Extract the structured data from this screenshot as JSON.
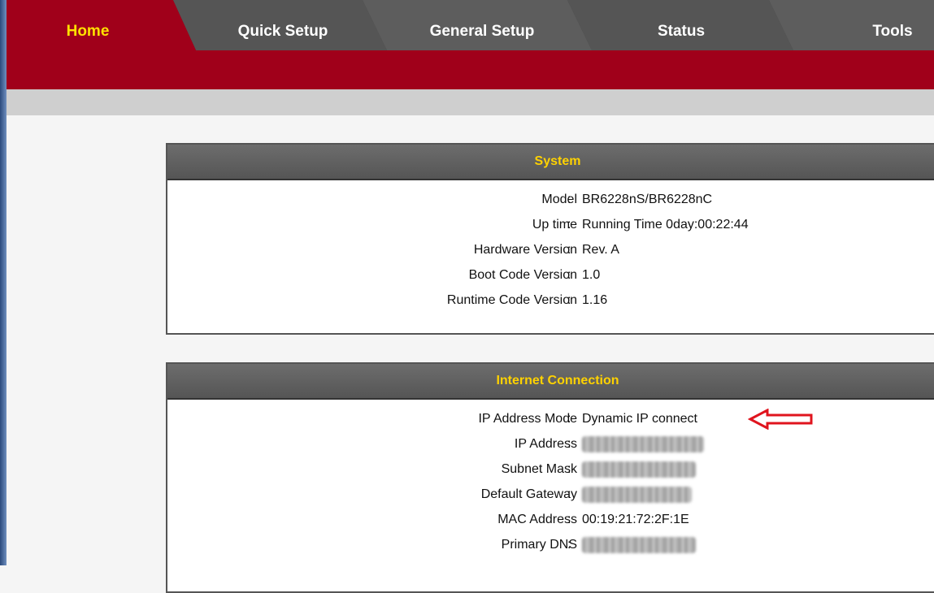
{
  "nav": {
    "tabs": [
      {
        "label": "Home",
        "active": true
      },
      {
        "label": "Quick Setup",
        "active": false
      },
      {
        "label": "General Setup",
        "active": false
      },
      {
        "label": "Status",
        "active": false
      },
      {
        "label": "Tools",
        "active": false
      }
    ]
  },
  "system": {
    "title": "System",
    "rows": [
      {
        "label": "Model",
        "value": "BR6228nS/BR6228nC"
      },
      {
        "label": "Up time",
        "value": "Running Time 0day:00:22:44"
      },
      {
        "label": "Hardware Version",
        "value": "Rev. A"
      },
      {
        "label": "Boot Code Version",
        "value": "1.0"
      },
      {
        "label": "Runtime Code Version",
        "value": "1.16"
      }
    ]
  },
  "internet": {
    "title": "Internet Connection",
    "rows": [
      {
        "label": "IP Address Mode",
        "value": "Dynamic IP connect"
      },
      {
        "label": "IP Address",
        "value": ""
      },
      {
        "label": "Subnet Mask",
        "value": ""
      },
      {
        "label": "Default Gateway",
        "value": ""
      },
      {
        "label": "MAC Address",
        "value": "00:19:21:72:2F:1E"
      },
      {
        "label": "Primary DNS",
        "value": ""
      }
    ]
  },
  "colors": {
    "tab_active_text": "#ffe100",
    "header_text": "#ffd200",
    "band_red": "#a0001a",
    "arrow": "#e0141e"
  },
  "sep": ":"
}
